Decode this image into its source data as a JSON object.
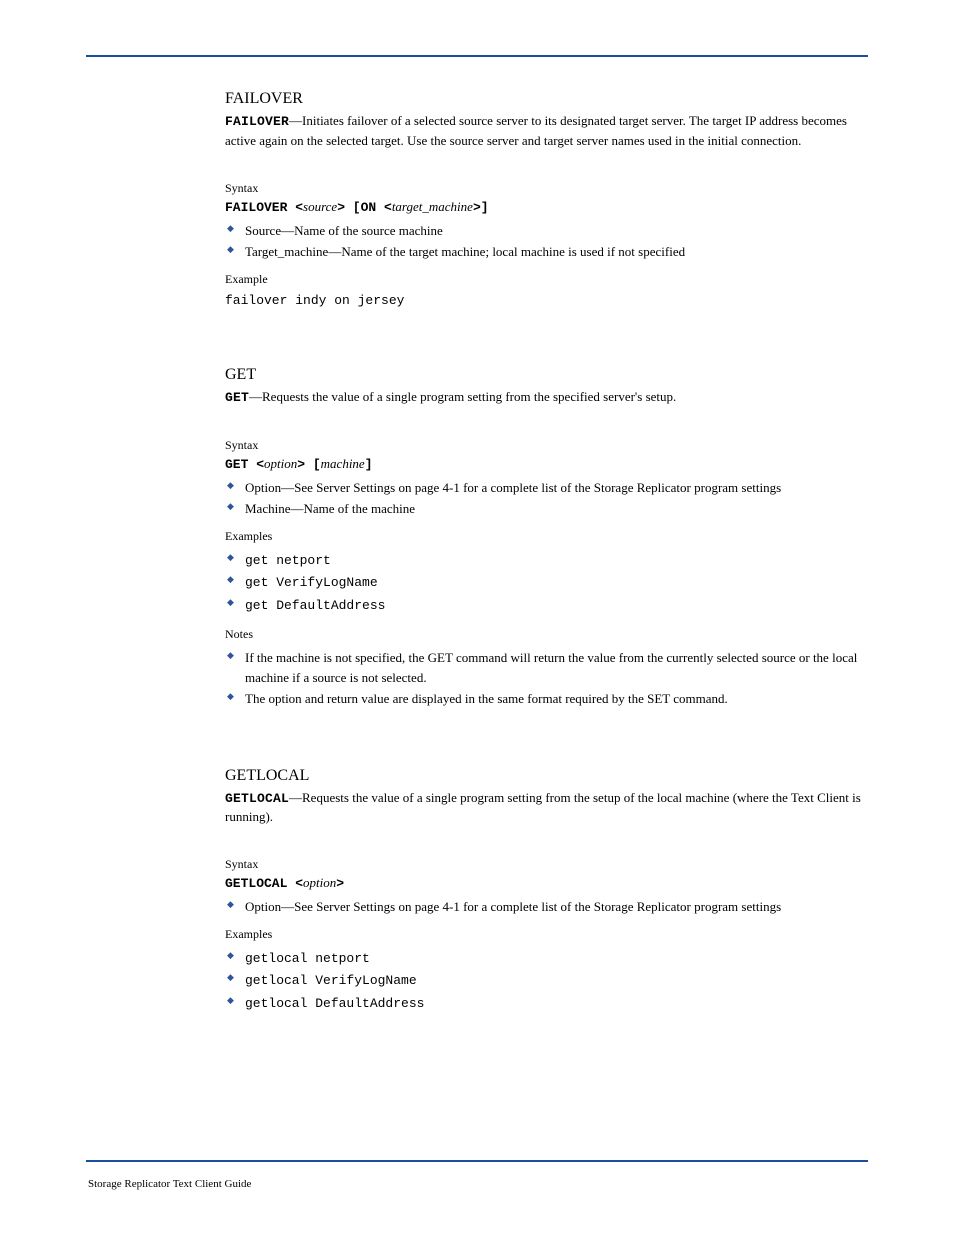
{
  "sections": {
    "failover": {
      "name": "FAILOVER",
      "command_token": "FAILOVER",
      "desc": "—Initiates failover of a selected source server to its designated target server. The target IP address becomes active again on the selected target. Use the source server and target server names used in the initial connection.",
      "syntax_label": "Syntax",
      "syntax_prefix": "FAILOVER <",
      "syntax_p1": "source",
      "syntax_mid": "> [ON <",
      "syntax_p2": "target_machine",
      "syntax_suffix": ">]",
      "b1": "Source—Name of the source machine",
      "b2": "Target_machine—Name of the target machine; local machine is used if not specified",
      "examples_label": "Example",
      "example": "failover indy on jersey"
    },
    "get": {
      "name": "GET",
      "command_token": "GET",
      "desc": "—Requests the value of a single program setting from the specified server's setup.",
      "syntax_label": "Syntax",
      "syntax_prefix": "GET <",
      "syntax_p1": "option",
      "syntax_mid": "> [",
      "syntax_p2": "machine",
      "syntax_suffix": "]",
      "b1": "Option—See Server Settings on page 4-1 for a complete list of the Storage Replicator program settings",
      "b2": "Machine—Name of the machine",
      "examples_label": "Examples",
      "ex1": "get netport",
      "ex2": "get VerifyLogName",
      "ex3": "get DefaultAddress",
      "notes_label": "Notes",
      "n1": "If the machine is not specified, the GET command will return the value from the currently selected source or the local machine if a source is not selected.",
      "n2": "The option and return value are displayed in the same format required by the SET command."
    },
    "getlocal": {
      "name": "GETLOCAL",
      "command_token": "GETLOCAL",
      "desc": "—Requests the value of a single program setting from the setup of the local machine (where the Text Client is running).",
      "syntax_label": "Syntax",
      "syntax_prefix": "GETLOCAL <",
      "syntax_p1": "option",
      "syntax_suffix": ">",
      "b1": "Option—See Server Settings on page 4-1 for a complete list of the Storage Replicator program settings",
      "examples_label": "Examples",
      "ex1": "getlocal netport",
      "ex2": "getlocal VerifyLogName",
      "ex3": "getlocal DefaultAddress"
    }
  },
  "footer": "Storage Replicator Text Client Guide"
}
